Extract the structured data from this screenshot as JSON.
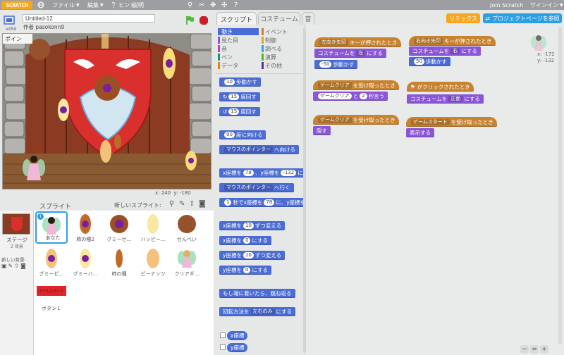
{
  "menubar": {
    "logo": "SCRATCH",
    "file": "ファイル",
    "edit": "編集",
    "tips": "ヒント",
    "about": "説明",
    "join": "Join Scratch",
    "signin": "サインイン"
  },
  "project": {
    "title": "Untitled-12",
    "author": "作者 pasokonn9",
    "version": "v459"
  },
  "stage": {
    "mouse_x": "x: 240",
    "mouse_y": "y: -180",
    "pointer_label": "ポイン"
  },
  "sprites_panel": {
    "title": "スプライト",
    "new_sprite": "新しいスプライト:",
    "stage_label": "ステージ",
    "stage_backdrops": "2 背景",
    "new_backdrop": "新しい背景:",
    "sprites": [
      {
        "name": "あなた",
        "badge": "i"
      },
      {
        "name": "柿の種2"
      },
      {
        "name": "グミーせ..."
      },
      {
        "name": "ハッピー..."
      },
      {
        "name": "せんべい"
      },
      {
        "name": "グミーピ..."
      },
      {
        "name": "グミーハ..."
      },
      {
        "name": "柿の種"
      },
      {
        "name": "ピーナッツ"
      },
      {
        "name": "クリアギ..."
      },
      {
        "name": "ボタン１",
        "thumb_text": "ゲームスタート"
      }
    ]
  },
  "tabs": {
    "scripts": "スクリプト",
    "costumes": "コスチューム",
    "sounds": "音"
  },
  "buttons": {
    "remix": "リミックス",
    "project_page": "プロジェクトページを参照"
  },
  "categories": [
    {
      "label": "動き",
      "color": "#4a6cd4"
    },
    {
      "label": "見た目",
      "color": "#8a55d7"
    },
    {
      "label": "音",
      "color": "#bb42c3"
    },
    {
      "label": "ペン",
      "color": "#0e9a6c"
    },
    {
      "label": "データ",
      "color": "#ee7d16"
    },
    {
      "label": "イベント",
      "color": "#c88330"
    },
    {
      "label": "制御",
      "color": "#e1a91a"
    },
    {
      "label": "調べる",
      "color": "#2ca5e2"
    },
    {
      "label": "演算",
      "color": "#5cb712"
    },
    {
      "label": "その他",
      "color": "#632d99"
    }
  ],
  "palette": {
    "move": "歩動かす",
    "move_val": "10",
    "turn_r": "度回す",
    "turn_r_val": "15",
    "turn_l": "度回す",
    "turn_l_val": "15",
    "point_dir": "度に向ける",
    "point_dir_val": "90",
    "point_to": "マウスのポインター",
    "point_to_suffix": "へ向ける",
    "goto_xy_x": "x座標を",
    "goto_xy_xval": "78",
    "goto_xy_y": "、y座標を",
    "goto_xy_yval": "-132",
    "goto_xy_suffix": "に",
    "goto": "マウスのポインター",
    "goto_suffix": "へ行く",
    "glide_val": "1",
    "glide_text": "秒でx座標を",
    "glide_xval": "78",
    "glide_mid": "に、y座標を",
    "change_x": "x座標を",
    "change_x_val": "10",
    "change_x_suffix": "ずつ変える",
    "set_x": "x座標を",
    "set_x_val": "0",
    "set_x_suffix": "にする",
    "change_y": "y座標を",
    "change_y_val": "10",
    "change_y_suffix": "ずつ変える",
    "set_y": "y座標を",
    "set_y_val": "0",
    "set_y_suffix": "にする",
    "bounce": "もし端に着いたら、跳ね返る",
    "rotation": "回転方法を",
    "rotation_val": "左右のみ",
    "rotation_suffix": "にする",
    "xpos": "x座標",
    "ypos": "y座標"
  },
  "scripts": {
    "s1_hat": "キーが押されたとき",
    "s1_key": "左向き矢印",
    "s1_costume": "コスチュームを",
    "s1_costume_val": "左",
    "s1_costume_suffix": "にする",
    "s1_move_val": "-50",
    "s1_move": "歩動かす",
    "s2_hat": "キーが押されたとき",
    "s2_key": "右向き矢印",
    "s2_costume": "コスチュームを",
    "s2_costume_val": "右",
    "s2_costume_suffix": "にする",
    "s2_move_val": "50",
    "s2_move": "歩動かす",
    "s3_hat": "を受け取ったとき",
    "s3_msg": "ゲームクリア",
    "s3_say": "と",
    "s3_say_msg": "ゲームクリア",
    "s3_say_val": "2",
    "s3_say_suffix": "秒言う",
    "s4_hat": "がクリックされたとき",
    "s4_costume": "コスチュームを",
    "s4_costume_val": "正面",
    "s4_costume_suffix": "にする",
    "s5_hat": "を受け取ったとき",
    "s5_msg": "ゲームクリア",
    "s5_action": "隠す",
    "s6_hat": "を受け取ったとき",
    "s6_msg": "ゲームスタート",
    "s6_action": "表示する",
    "sprite_x": "x: -172",
    "sprite_y": "y: -132"
  },
  "colors": {
    "motion": "#4a6cd4",
    "events": "#c88330",
    "looks": "#8a55d7",
    "remix": "#f7a71b",
    "project_page": "#2e9ee0"
  }
}
